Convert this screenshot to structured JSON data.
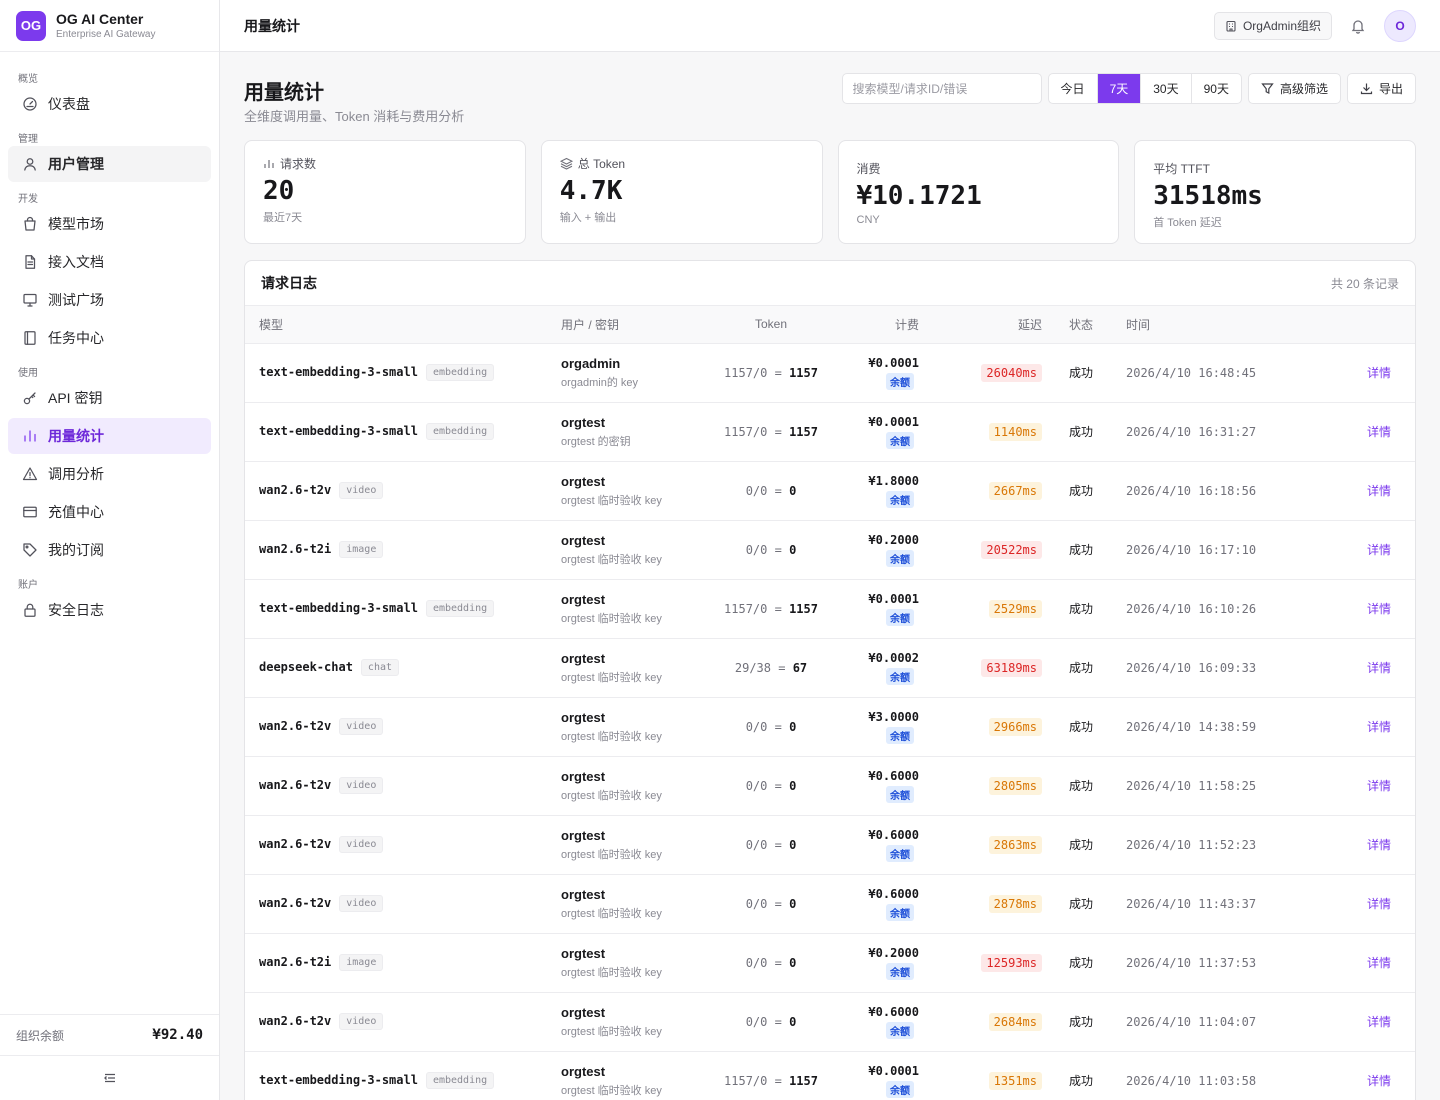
{
  "brand": {
    "logo": "OG",
    "name": "OG AI Center",
    "subtitle": "Enterprise AI Gateway"
  },
  "sidebar": {
    "sections": [
      {
        "label": "概览",
        "items": [
          {
            "label": "仪表盘",
            "icon": "gauge-icon",
            "name": "dashboard"
          }
        ]
      },
      {
        "label": "管理",
        "items": [
          {
            "label": "用户管理",
            "icon": "user-icon",
            "name": "users"
          }
        ]
      },
      {
        "label": "开发",
        "items": [
          {
            "label": "模型市场",
            "icon": "bag-icon",
            "name": "model-market"
          },
          {
            "label": "接入文档",
            "icon": "document-icon",
            "name": "docs"
          },
          {
            "label": "测试广场",
            "icon": "monitor-icon",
            "name": "playground"
          },
          {
            "label": "任务中心",
            "icon": "notebook-icon",
            "name": "tasks"
          }
        ]
      },
      {
        "label": "使用",
        "items": [
          {
            "label": "API 密钥",
            "icon": "key-icon",
            "name": "api-keys"
          },
          {
            "label": "用量统计",
            "icon": "bar-chart-icon",
            "name": "usage"
          },
          {
            "label": "调用分析",
            "icon": "warning-icon",
            "name": "analysis"
          },
          {
            "label": "充值中心",
            "icon": "card-icon",
            "name": "recharge"
          },
          {
            "label": "我的订阅",
            "icon": "tag-icon",
            "name": "subscription"
          }
        ]
      },
      {
        "label": "账户",
        "items": [
          {
            "label": "安全日志",
            "icon": "lock-icon",
            "name": "security-log"
          }
        ]
      }
    ],
    "balance_label": "组织余额",
    "balance_value": "¥92.40"
  },
  "topbar": {
    "title": "用量统计",
    "org": "OrgAdmin组织",
    "avatar": "O"
  },
  "page": {
    "title": "用量统计",
    "subtitle": "全维度调用量、Token 消耗与费用分析",
    "search_placeholder": "搜索模型/请求ID/错误",
    "ranges": [
      "今日",
      "7天",
      "30天",
      "90天"
    ],
    "active_range": "7天",
    "filter_label": "高级筛选",
    "export_label": "导出"
  },
  "stats": [
    {
      "label": "请求数",
      "value": "20",
      "hint": "最近7天"
    },
    {
      "label": "总 Token",
      "value": "4.7K",
      "hint": "输入 + 输出"
    },
    {
      "label": "消费",
      "value": "¥10.1721",
      "hint": "CNY"
    },
    {
      "label": "平均 TTFT",
      "value": "31518ms",
      "hint": "首 Token 延迟"
    }
  ],
  "logs": {
    "title": "请求日志",
    "count": "共 20 条记录",
    "columns": [
      "模型",
      "用户 / 密钥",
      "Token",
      "计费",
      "延迟",
      "状态",
      "时间",
      ""
    ],
    "billing_tag": "余额",
    "detail_label": "详情",
    "rows": [
      {
        "model": "text-embedding-3-small",
        "type": "embedding",
        "user": "orgadmin",
        "key": "orgadmin的 key",
        "tok_in": "1157",
        "tok_out": "0",
        "tok_total": "1157",
        "cost": "¥0.0001",
        "latency": "26040ms",
        "lat_level": "red",
        "status": "成功",
        "time": "2026/4/10 16:48:45"
      },
      {
        "model": "text-embedding-3-small",
        "type": "embedding",
        "user": "orgtest",
        "key": "orgtest 的密钥",
        "tok_in": "1157",
        "tok_out": "0",
        "tok_total": "1157",
        "cost": "¥0.0001",
        "latency": "1140ms",
        "lat_level": "amber",
        "status": "成功",
        "time": "2026/4/10 16:31:27"
      },
      {
        "model": "wan2.6-t2v",
        "type": "video",
        "user": "orgtest",
        "key": "orgtest 临时验收 key",
        "tok_in": "0",
        "tok_out": "0",
        "tok_total": "0",
        "cost": "¥1.8000",
        "latency": "2667ms",
        "lat_level": "amber",
        "status": "成功",
        "time": "2026/4/10 16:18:56"
      },
      {
        "model": "wan2.6-t2i",
        "type": "image",
        "user": "orgtest",
        "key": "orgtest 临时验收 key",
        "tok_in": "0",
        "tok_out": "0",
        "tok_total": "0",
        "cost": "¥0.2000",
        "latency": "20522ms",
        "lat_level": "red",
        "status": "成功",
        "time": "2026/4/10 16:17:10"
      },
      {
        "model": "text-embedding-3-small",
        "type": "embedding",
        "user": "orgtest",
        "key": "orgtest 临时验收 key",
        "tok_in": "1157",
        "tok_out": "0",
        "tok_total": "1157",
        "cost": "¥0.0001",
        "latency": "2529ms",
        "lat_level": "amber",
        "status": "成功",
        "time": "2026/4/10 16:10:26"
      },
      {
        "model": "deepseek-chat",
        "type": "chat",
        "user": "orgtest",
        "key": "orgtest 临时验收 key",
        "tok_in": "29",
        "tok_out": "38",
        "tok_total": "67",
        "cost": "¥0.0002",
        "latency": "63189ms",
        "lat_level": "red",
        "status": "成功",
        "time": "2026/4/10 16:09:33"
      },
      {
        "model": "wan2.6-t2v",
        "type": "video",
        "user": "orgtest",
        "key": "orgtest 临时验收 key",
        "tok_in": "0",
        "tok_out": "0",
        "tok_total": "0",
        "cost": "¥3.0000",
        "latency": "2966ms",
        "lat_level": "amber",
        "status": "成功",
        "time": "2026/4/10 14:38:59"
      },
      {
        "model": "wan2.6-t2v",
        "type": "video",
        "user": "orgtest",
        "key": "orgtest 临时验收 key",
        "tok_in": "0",
        "tok_out": "0",
        "tok_total": "0",
        "cost": "¥0.6000",
        "latency": "2805ms",
        "lat_level": "amber",
        "status": "成功",
        "time": "2026/4/10 11:58:25"
      },
      {
        "model": "wan2.6-t2v",
        "type": "video",
        "user": "orgtest",
        "key": "orgtest 临时验收 key",
        "tok_in": "0",
        "tok_out": "0",
        "tok_total": "0",
        "cost": "¥0.6000",
        "latency": "2863ms",
        "lat_level": "amber",
        "status": "成功",
        "time": "2026/4/10 11:52:23"
      },
      {
        "model": "wan2.6-t2v",
        "type": "video",
        "user": "orgtest",
        "key": "orgtest 临时验收 key",
        "tok_in": "0",
        "tok_out": "0",
        "tok_total": "0",
        "cost": "¥0.6000",
        "latency": "2878ms",
        "lat_level": "amber",
        "status": "成功",
        "time": "2026/4/10 11:43:37"
      },
      {
        "model": "wan2.6-t2i",
        "type": "image",
        "user": "orgtest",
        "key": "orgtest 临时验收 key",
        "tok_in": "0",
        "tok_out": "0",
        "tok_total": "0",
        "cost": "¥0.2000",
        "latency": "12593ms",
        "lat_level": "red",
        "status": "成功",
        "time": "2026/4/10 11:37:53"
      },
      {
        "model": "wan2.6-t2v",
        "type": "video",
        "user": "orgtest",
        "key": "orgtest 临时验收 key",
        "tok_in": "0",
        "tok_out": "0",
        "tok_total": "0",
        "cost": "¥0.6000",
        "latency": "2684ms",
        "lat_level": "amber",
        "status": "成功",
        "time": "2026/4/10 11:04:07"
      },
      {
        "model": "text-embedding-3-small",
        "type": "embedding",
        "user": "orgtest",
        "key": "orgtest 临时验收 key",
        "tok_in": "1157",
        "tok_out": "0",
        "tok_total": "1157",
        "cost": "¥0.0001",
        "latency": "1351ms",
        "lat_level": "amber",
        "status": "成功",
        "time": "2026/4/10 11:03:58"
      }
    ]
  },
  "colors": {
    "accent": "#7c3aed",
    "latency_red": "#dc2626",
    "latency_amber": "#d97706",
    "balance_tag": "#1d4ed8"
  }
}
